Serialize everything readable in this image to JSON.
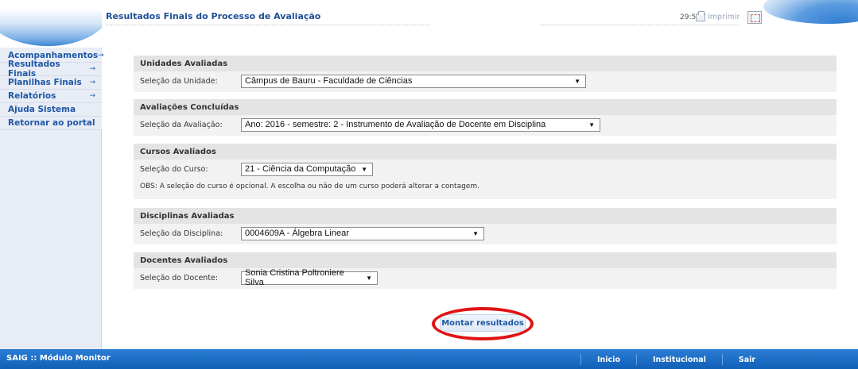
{
  "header": {
    "title": "Resultados Finais do Processo de Avaliação",
    "timer": "29:55",
    "print_label": "Imprimir"
  },
  "sidebar": {
    "items": [
      {
        "label": "Acompanhamentos",
        "arrow": "→"
      },
      {
        "label": "Resultados Finais",
        "arrow": "→"
      },
      {
        "label": "Planilhas Finais",
        "arrow": "→"
      },
      {
        "label": "Relatórios",
        "arrow": "→"
      },
      {
        "label": "Ajuda Sistema",
        "arrow": ""
      },
      {
        "label": "Retornar ao portal",
        "arrow": ""
      }
    ]
  },
  "panels": {
    "unidades": {
      "header": "Unidades Avaliadas",
      "label": "Seleção da Unidade:",
      "value": "Câmpus de Bauru - Faculdade de Ciências"
    },
    "avaliacoes": {
      "header": "Avaliações Concluídas",
      "label": "Seleção da Avaliação:",
      "value": "Ano: 2016 - semestre: 2 - Instrumento de Avaliação de Docente em Disciplina"
    },
    "cursos": {
      "header": "Cursos Avaliados",
      "label": "Seleção do Curso:",
      "value": "21 - Ciência da Computação",
      "obs": "OBS:  A seleção do curso é opcional.   A escolha ou não de um curso poderá alterar a contagem."
    },
    "disciplinas": {
      "header": "Disciplinas Avaliadas",
      "label": "Seleção da Disciplina:",
      "value": "0004609A - Álgebra Linear"
    },
    "docentes": {
      "header": "Docentes Avaliados",
      "label": "Seleção do Docente:",
      "value": "Sonia Cristina Poltroniere Silva"
    }
  },
  "actions": {
    "submit_label": "Montar resultados"
  },
  "footer": {
    "brand": "SAIG :: Módulo Monitor",
    "nav": [
      "Inicio",
      "Institucional",
      "Sair"
    ]
  },
  "colors": {
    "accent": "#1f58a6",
    "highlight": "#e01313",
    "footer": "#1160b8"
  }
}
